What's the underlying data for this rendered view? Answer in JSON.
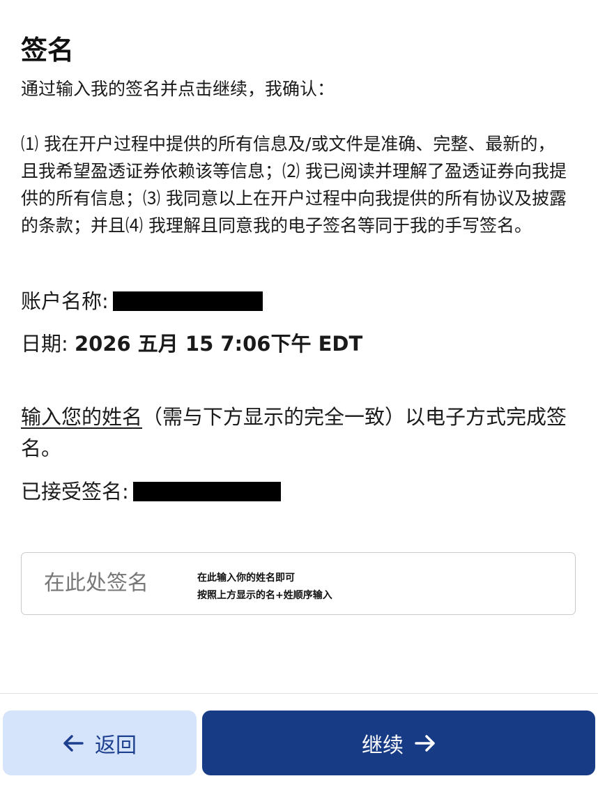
{
  "page": {
    "title": "签名",
    "intro": "通过输入我的签名并点击继续，我确认：",
    "terms": "⑴ 我在开户过程中提供的所有信息及/或文件是准确、完整、最新的，且我希望盈透证券依赖该等信息；⑵ 我已阅读并理解了盈透证券向我提供的所有信息；⑶ 我同意以上在开户过程中向我提供的所有协议及披露的条款；并且⑷ 我理解且同意我的电子签名等同于我的手写签名。"
  },
  "account": {
    "label": "账户名称:",
    "value_redacted": true
  },
  "date": {
    "label": "日期:",
    "value": "2026 五月 15 7:06下午 EDT"
  },
  "instruction": {
    "link_text": "输入您的姓名",
    "rest_text": "（需与下方显示的完全一致）以电子方式完成签名。"
  },
  "accepted": {
    "label": "已接受签名:",
    "value_redacted": true
  },
  "signature": {
    "placeholder": "在此处签名",
    "value": "",
    "hint_line1": "在此输入你的姓名即可",
    "hint_line2": "按照上方显示的名+姓顺序输入"
  },
  "footer": {
    "back_label": "返回",
    "continue_label": "继续",
    "back_icon": "arrow-left-icon",
    "continue_icon": "arrow-right-icon"
  },
  "colors": {
    "primary": "#183b85",
    "secondary_bg": "#d6e4fb",
    "secondary_fg": "#1d3f8f"
  }
}
